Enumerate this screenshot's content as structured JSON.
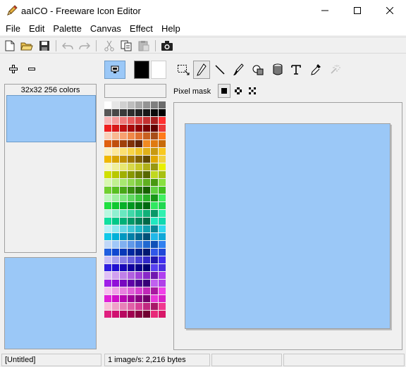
{
  "window": {
    "title": "aaICO - Freeware Icon Editor"
  },
  "menu": [
    "File",
    "Edit",
    "Palette",
    "Canvas",
    "Effect",
    "Help"
  ],
  "image_list": {
    "header": "32x32 256 colors"
  },
  "pixel_mask": {
    "label": "Pixel mask"
  },
  "status": {
    "file": "[Untitled]",
    "info": "1 image/s: 2,216 bytes"
  },
  "colors": {
    "image_fill": "#9bc8f7",
    "foreground": "#000000",
    "background": "#ffffff"
  },
  "palette": [
    "#ffffff",
    "#e6e6e6",
    "#d0d0d0",
    "#bdbdbd",
    "#a8a8a8",
    "#949494",
    "#808080",
    "#6b6b6b",
    "#585858",
    "#474747",
    "#3a3a3a",
    "#2d2d2d",
    "#222222",
    "#171717",
    "#0b0b0b",
    "#000000",
    "#f7b7b7",
    "#f59a9a",
    "#ef7a7a",
    "#e85a5a",
    "#d94040",
    "#c43030",
    "#a82020",
    "#ff3030",
    "#ef2020",
    "#d81818",
    "#c01010",
    "#a80808",
    "#900000",
    "#780000",
    "#600000",
    "#e83838",
    "#fbd0b8",
    "#f9b890",
    "#f7a070",
    "#f08848",
    "#e07030",
    "#c86020",
    "#a84e18",
    "#ff7a1a",
    "#e06010",
    "#c04f0c",
    "#a0400a",
    "#803208",
    "#602406",
    "#f08a20",
    "#e07a10",
    "#c86a08",
    "#fdf0c0",
    "#fde89a",
    "#fce070",
    "#f8d448",
    "#f0c428",
    "#e0b018",
    "#c89a10",
    "#f8c820",
    "#f0b800",
    "#d8a400",
    "#c09000",
    "#a07800",
    "#806000",
    "#604800",
    "#e0a800",
    "#f0d040",
    "#f8f8c0",
    "#f0f09a",
    "#e8e870",
    "#d8d848",
    "#c8c828",
    "#b0b018",
    "#989810",
    "#e8f000",
    "#d0e000",
    "#b8c800",
    "#a0b000",
    "#889800",
    "#708000",
    "#586800",
    "#c0d820",
    "#a8c010",
    "#d8f8b0",
    "#c0f090",
    "#a8e870",
    "#90d850",
    "#78c838",
    "#60b020",
    "#489810",
    "#88e040",
    "#70d030",
    "#58c020",
    "#48a818",
    "#389010",
    "#287808",
    "#186000",
    "#60d040",
    "#40c020",
    "#c0f8c0",
    "#a0f0a0",
    "#80e880",
    "#60d860",
    "#40c840",
    "#28b028",
    "#189818",
    "#40f060",
    "#20e040",
    "#10c830",
    "#08b028",
    "#009820",
    "#008018",
    "#006810",
    "#30e860",
    "#20d850",
    "#b8f8e0",
    "#90f0d0",
    "#68e8c0",
    "#40d8a8",
    "#20c890",
    "#10b078",
    "#089868",
    "#30f0b0",
    "#10e0a0",
    "#00c888",
    "#00b078",
    "#009868",
    "#008058",
    "#006848",
    "#20e8c0",
    "#10d8b0",
    "#b8f0f8",
    "#90e8f0",
    "#68d8e8",
    "#40c8d8",
    "#20b8c8",
    "#10a0b0",
    "#088898",
    "#30d8f0",
    "#10c8e8",
    "#00b0d8",
    "#0098c0",
    "#0080a8",
    "#006890",
    "#005078",
    "#20b8e8",
    "#10a8d8",
    "#c0d8f8",
    "#a0c8f8",
    "#80b0f0",
    "#6098e8",
    "#4080e0",
    "#2068d0",
    "#1050b8",
    "#3080f0",
    "#2060e0",
    "#1048d0",
    "#0838b8",
    "#0028a0",
    "#002088",
    "#001870",
    "#3058e8",
    "#2048d8",
    "#c8c0f8",
    "#a8a0f0",
    "#8880e8",
    "#6860e0",
    "#4840d8",
    "#3028c8",
    "#2018b0",
    "#4030f0",
    "#3020e0",
    "#2010d0",
    "#1808b8",
    "#1000a0",
    "#080088",
    "#000070",
    "#5840f0",
    "#4830e0",
    "#e0c0f8",
    "#d0a0f0",
    "#c080e8",
    "#b060e0",
    "#a040d8",
    "#8828c8",
    "#7018b0",
    "#b040f0",
    "#a020e8",
    "#9010d8",
    "#7808c0",
    "#6000a8",
    "#480090",
    "#380078",
    "#c060f0",
    "#b040e8",
    "#f8c0f0",
    "#f0a0e8",
    "#e880e0",
    "#e060d8",
    "#d840d0",
    "#c028b8",
    "#a818a0",
    "#f040e8",
    "#e020d8",
    "#d010c8",
    "#b808b0",
    "#a00098",
    "#880080",
    "#700068",
    "#e838d8",
    "#d820c8",
    "#f8c0d8",
    "#f0a0c8",
    "#e880b8",
    "#e060a8",
    "#d84098",
    "#c02880",
    "#a81868",
    "#f03890",
    "#e02080",
    "#d01070",
    "#b80860",
    "#a00050",
    "#880040",
    "#700030",
    "#e82878",
    "#d81868"
  ]
}
